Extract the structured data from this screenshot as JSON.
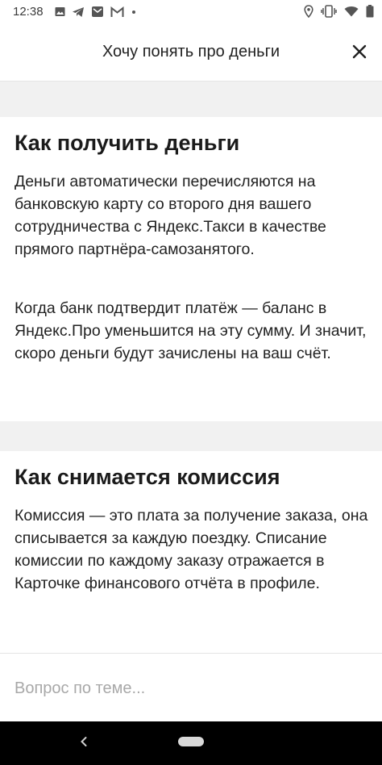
{
  "status_bar": {
    "time": "12:38",
    "left_icons": [
      "image-icon",
      "telegram-icon",
      "message-icon",
      "gmail-icon",
      "dot-icon"
    ],
    "right_icons": [
      "location-icon",
      "vibrate-icon",
      "wifi-icon",
      "battery-icon"
    ]
  },
  "header": {
    "title": "Хочу понять про деньги",
    "close_icon": "close-icon"
  },
  "sections": [
    {
      "heading": "Как получить деньги",
      "paragraphs": [
        "Деньги автоматически перечисляются на банковскую карту со второго дня вашего сотрудничества с Яндекс.Такси в качестве прямого партнёра-самозанятого.",
        "Когда банк подтвердит платёж — баланс в Яндекс.Про уменьшится на эту сумму. И значит, скоро деньги будут зачислены на ваш счёт."
      ]
    },
    {
      "heading": "Как снимается комиссия",
      "paragraphs": [
        "Комиссия — это плата за получение заказа, она списывается за каждую поездку. Списание комиссии по каждому заказу отражается в Карточке финансового отчёта в профиле."
      ]
    }
  ],
  "question_input": {
    "placeholder": "Вопрос по теме...",
    "value": ""
  },
  "nav_bar": {
    "back_icon": "back-chevron-icon",
    "home_icon": "home-pill-icon"
  }
}
